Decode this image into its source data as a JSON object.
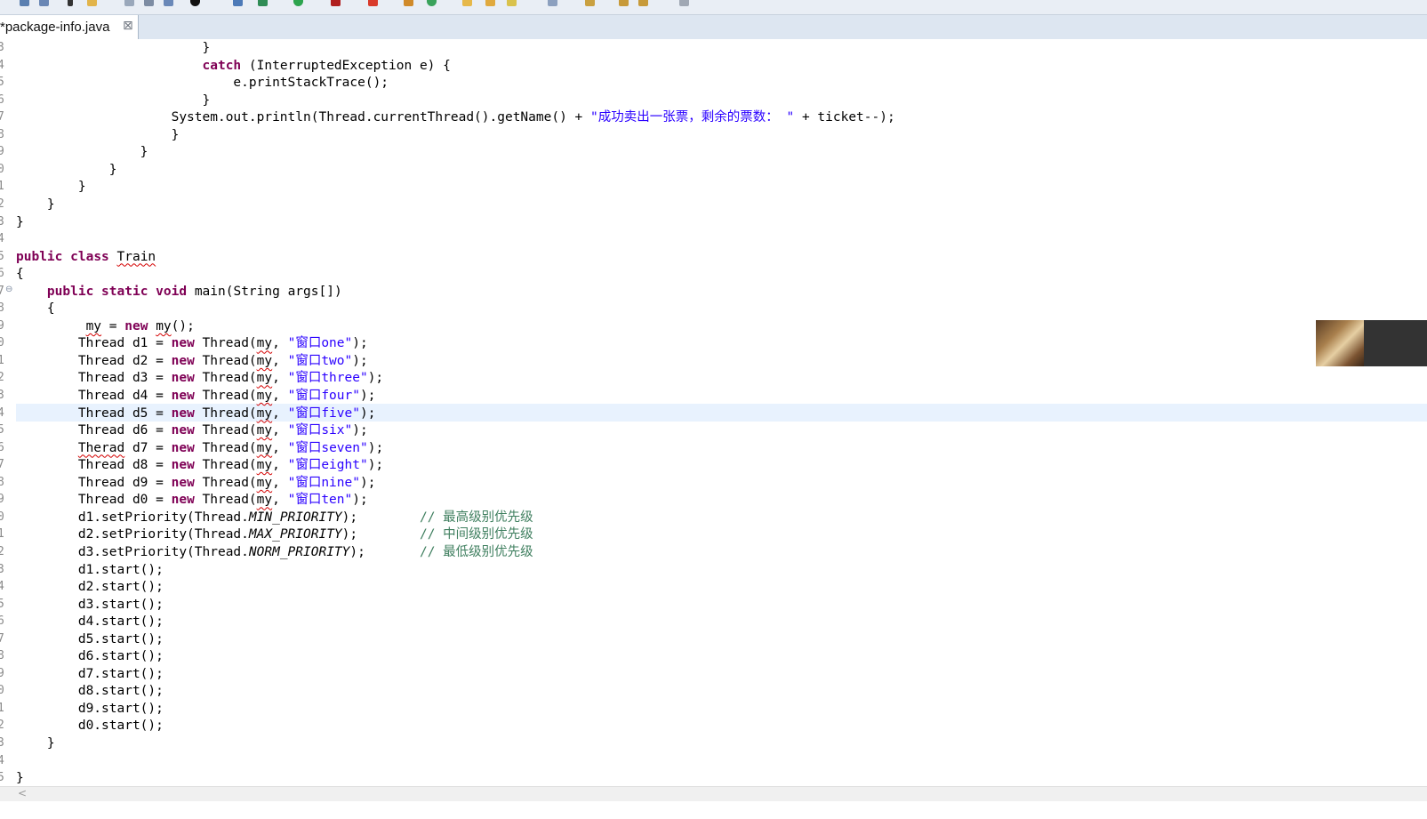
{
  "tab": {
    "title": "*package-info.java",
    "close_glyph": "⊠"
  },
  "gutter": {
    "line_numbers": [
      "3",
      "4",
      "5",
      "6",
      "7",
      "8",
      "9",
      "0",
      "1",
      "2",
      "3",
      "4",
      "5",
      "6",
      "7",
      "8",
      "9",
      "0",
      "1",
      "2",
      "3",
      "4",
      "5",
      "6",
      "7",
      "8",
      "9",
      "0",
      "1",
      "2",
      "3",
      "4",
      "5",
      "6",
      "7",
      "8",
      "9",
      "0",
      "1",
      "2",
      "3",
      "4",
      "5"
    ]
  },
  "scrollbar": {
    "left_arrow": "<"
  },
  "colors": {
    "keyword": "#7f0055",
    "string": "#2a00ff",
    "comment": "#3f7f5f",
    "current_line": "#e8f2fe"
  },
  "code": [
    [
      [
        "",
        "                        }"
      ]
    ],
    [
      [
        "",
        "                        "
      ],
      [
        "kw",
        "catch"
      ],
      [
        "",
        " (InterruptedException e) {"
      ]
    ],
    [
      [
        "",
        "                            e.printStackTrace();"
      ]
    ],
    [
      [
        "",
        "                        }"
      ]
    ],
    [
      [
        "",
        "                    System.out.println(Thread.currentThread().getName() + "
      ],
      [
        "str",
        "\"成功卖出一张票，剩余的票数： \""
      ],
      [
        "",
        " + ticket--);"
      ]
    ],
    [
      [
        "",
        "                    }"
      ]
    ],
    [
      [
        "",
        "                }"
      ]
    ],
    [
      [
        "",
        "            }"
      ]
    ],
    [
      [
        "",
        "        }"
      ]
    ],
    [
      [
        "",
        "    }"
      ]
    ],
    [
      [
        "",
        "}"
      ]
    ],
    [
      [
        "",
        ""
      ]
    ],
    [
      [
        "kw",
        "public"
      ],
      [
        "",
        " "
      ],
      [
        "kw",
        "class"
      ],
      [
        "",
        " "
      ],
      [
        "squig",
        "Train"
      ]
    ],
    [
      [
        "",
        "{"
      ]
    ],
    [
      [
        "",
        "    "
      ],
      [
        "kw",
        "public"
      ],
      [
        "",
        " "
      ],
      [
        "kw",
        "static"
      ],
      [
        "",
        " "
      ],
      [
        "kw",
        "void"
      ],
      [
        "",
        " main(String args[])"
      ]
    ],
    [
      [
        "",
        "    {"
      ]
    ],
    [
      [
        "",
        "         "
      ],
      [
        "squig",
        "my"
      ],
      [
        "",
        " = "
      ],
      [
        "kw",
        "new"
      ],
      [
        "",
        " "
      ],
      [
        "squig",
        "my"
      ],
      [
        "",
        "();"
      ]
    ],
    [
      [
        "",
        "        Thread d1 = "
      ],
      [
        "kw",
        "new"
      ],
      [
        "",
        " Thread("
      ],
      [
        "squig",
        "my"
      ],
      [
        "",
        ", "
      ],
      [
        "str",
        "\"窗口one\""
      ],
      [
        "",
        ");"
      ]
    ],
    [
      [
        "",
        "        Thread d2 = "
      ],
      [
        "kw",
        "new"
      ],
      [
        "",
        " Thread("
      ],
      [
        "squig",
        "my"
      ],
      [
        "",
        ", "
      ],
      [
        "str",
        "\"窗口two\""
      ],
      [
        "",
        ");"
      ]
    ],
    [
      [
        "",
        "        Thread d3 = "
      ],
      [
        "kw",
        "new"
      ],
      [
        "",
        " Thread("
      ],
      [
        "squig",
        "my"
      ],
      [
        "",
        ", "
      ],
      [
        "str",
        "\"窗口three\""
      ],
      [
        "",
        ");"
      ]
    ],
    [
      [
        "",
        "        Thread d4 = "
      ],
      [
        "kw",
        "new"
      ],
      [
        "",
        " Thread("
      ],
      [
        "squig",
        "my"
      ],
      [
        "",
        ", "
      ],
      [
        "str",
        "\"窗口four\""
      ],
      [
        "",
        ");"
      ]
    ],
    [
      [
        "",
        "        Thread d5 = "
      ],
      [
        "kw",
        "new"
      ],
      [
        "",
        " Thread("
      ],
      [
        "squig",
        "my"
      ],
      [
        "",
        ", "
      ],
      [
        "str",
        "\"窗口five\""
      ],
      [
        "",
        ");"
      ]
    ],
    [
      [
        "",
        "        Thread d6 = "
      ],
      [
        "kw",
        "new"
      ],
      [
        "",
        " Thread("
      ],
      [
        "squig",
        "my"
      ],
      [
        "",
        ", "
      ],
      [
        "str",
        "\"窗口six\""
      ],
      [
        "",
        ");"
      ]
    ],
    [
      [
        "",
        "        "
      ],
      [
        "squig",
        "Therad"
      ],
      [
        "",
        " d7 = "
      ],
      [
        "kw",
        "new"
      ],
      [
        "",
        " Thread("
      ],
      [
        "squig",
        "my"
      ],
      [
        "",
        ", "
      ],
      [
        "str",
        "\"窗口seven\""
      ],
      [
        "",
        ");"
      ]
    ],
    [
      [
        "",
        "        Thread d8 = "
      ],
      [
        "kw",
        "new"
      ],
      [
        "",
        " Thread("
      ],
      [
        "squig",
        "my"
      ],
      [
        "",
        ", "
      ],
      [
        "str",
        "\"窗口eight\""
      ],
      [
        "",
        ");"
      ]
    ],
    [
      [
        "",
        "        Thread d9 = "
      ],
      [
        "kw",
        "new"
      ],
      [
        "",
        " Thread("
      ],
      [
        "squig",
        "my"
      ],
      [
        "",
        ", "
      ],
      [
        "str",
        "\"窗口nine\""
      ],
      [
        "",
        ");"
      ]
    ],
    [
      [
        "",
        "        Thread d0 = "
      ],
      [
        "kw",
        "new"
      ],
      [
        "",
        " Thread("
      ],
      [
        "squig",
        "my"
      ],
      [
        "",
        ", "
      ],
      [
        "str",
        "\"窗口ten\""
      ],
      [
        "",
        ");"
      ]
    ],
    [
      [
        "",
        "        d1.setPriority(Thread."
      ],
      [
        "const",
        "MIN_PRIORITY"
      ],
      [
        "",
        ");        "
      ],
      [
        "cm",
        "// 最高级别优先级"
      ]
    ],
    [
      [
        "",
        "        d2.setPriority(Thread."
      ],
      [
        "const",
        "MAX_PRIORITY"
      ],
      [
        "",
        ");        "
      ],
      [
        "cm",
        "// 中间级别优先级"
      ]
    ],
    [
      [
        "",
        "        d3.setPriority(Thread."
      ],
      [
        "const",
        "NORM_PRIORITY"
      ],
      [
        "",
        ");       "
      ],
      [
        "cm",
        "// 最低级别优先级"
      ]
    ],
    [
      [
        "",
        "        d1.start();"
      ]
    ],
    [
      [
        "",
        "        d2.start();"
      ]
    ],
    [
      [
        "",
        "        d3.start();"
      ]
    ],
    [
      [
        "",
        "        d4.start();"
      ]
    ],
    [
      [
        "",
        "        d5.start();"
      ]
    ],
    [
      [
        "",
        "        d6.start();"
      ]
    ],
    [
      [
        "",
        "        d7.start();"
      ]
    ],
    [
      [
        "",
        "        d8.start();"
      ]
    ],
    [
      [
        "",
        "        d9.start();"
      ]
    ],
    [
      [
        "",
        "        d0.start();"
      ]
    ],
    [
      [
        "",
        "    }"
      ]
    ],
    [
      [
        "",
        ""
      ]
    ],
    [
      [
        "",
        "}"
      ]
    ]
  ]
}
